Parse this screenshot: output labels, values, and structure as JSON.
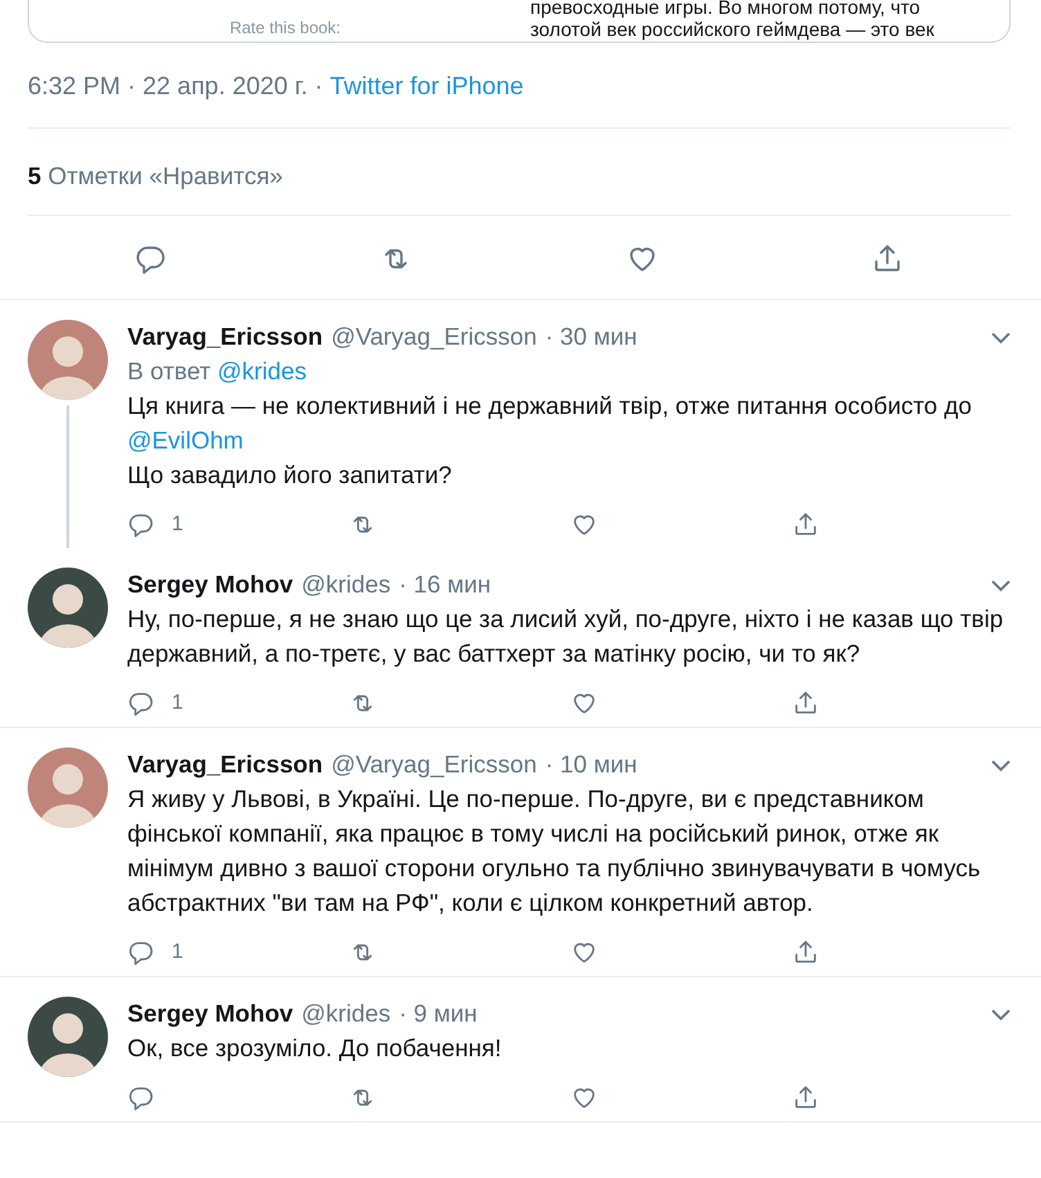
{
  "embed_card": {
    "caption": "Rate this book:",
    "lines": [
      "превосходные игры. Во многом потому, что",
      "золотой век российского геймдева — это век"
    ]
  },
  "tweet_meta": {
    "time": "6:32 PM · 22 апр. 2020 г. · ",
    "source": "Twitter for iPhone"
  },
  "likes": {
    "count": "5",
    "label": "Отметки «Нравится»"
  },
  "replies": [
    {
      "name": "Varyag_Ericsson",
      "handle": "@Varyag_Ericsson",
      "time": "· 30 мин",
      "color": "#c0857a",
      "thread_line": true,
      "reply_to": {
        "label": "В ответ",
        "mention": "@krides"
      },
      "paragraphs": [
        [
          {
            "kind": "text",
            "text": "Ця книга — не колективний і не державний твір, отже питання особисто до "
          },
          {
            "kind": "mention",
            "text": "@EvilOhm"
          }
        ],
        [
          {
            "kind": "text",
            "text": "Що завадило його запитати?"
          }
        ]
      ],
      "reply_count": "1"
    },
    {
      "name": "Sergey Mohov",
      "handle": "@krides",
      "time": "· 16 мин",
      "color": "#3c4a45",
      "thread_line": false,
      "paragraphs": [
        [
          {
            "kind": "text",
            "text": "Ну, по-перше, я не знаю що це за лисий хуй, по-друге, ніхто і не казав що твір державний, а по-третє, у вас баттхерт за матінку росію, чи то як?"
          }
        ]
      ],
      "reply_count": "1"
    },
    {
      "name": "Varyag_Ericsson",
      "handle": "@Varyag_Ericsson",
      "time": "· 10 мин",
      "color": "#c0857a",
      "thread_line": false,
      "paragraphs": [
        [
          {
            "kind": "text",
            "text": "Я живу у Львові, в Україні. Це по-перше. По-друге, ви є представником фінської компанії, яка працює в тому числі на російський ринок, отже як мінімум дивно з вашої сторони огульно та публічно звинувачувати в чомусь абстрактних \"ви там на РФ\", коли є цілком конкретний автор."
          }
        ]
      ],
      "reply_count": "1"
    },
    {
      "name": "Sergey Mohov",
      "handle": "@krides",
      "time": "· 9 мин",
      "color": "#3c4a45",
      "thread_line": false,
      "paragraphs": [
        [
          {
            "kind": "text",
            "text": "Ок, все зрозуміло. До побачення!"
          }
        ]
      ]
    }
  ]
}
